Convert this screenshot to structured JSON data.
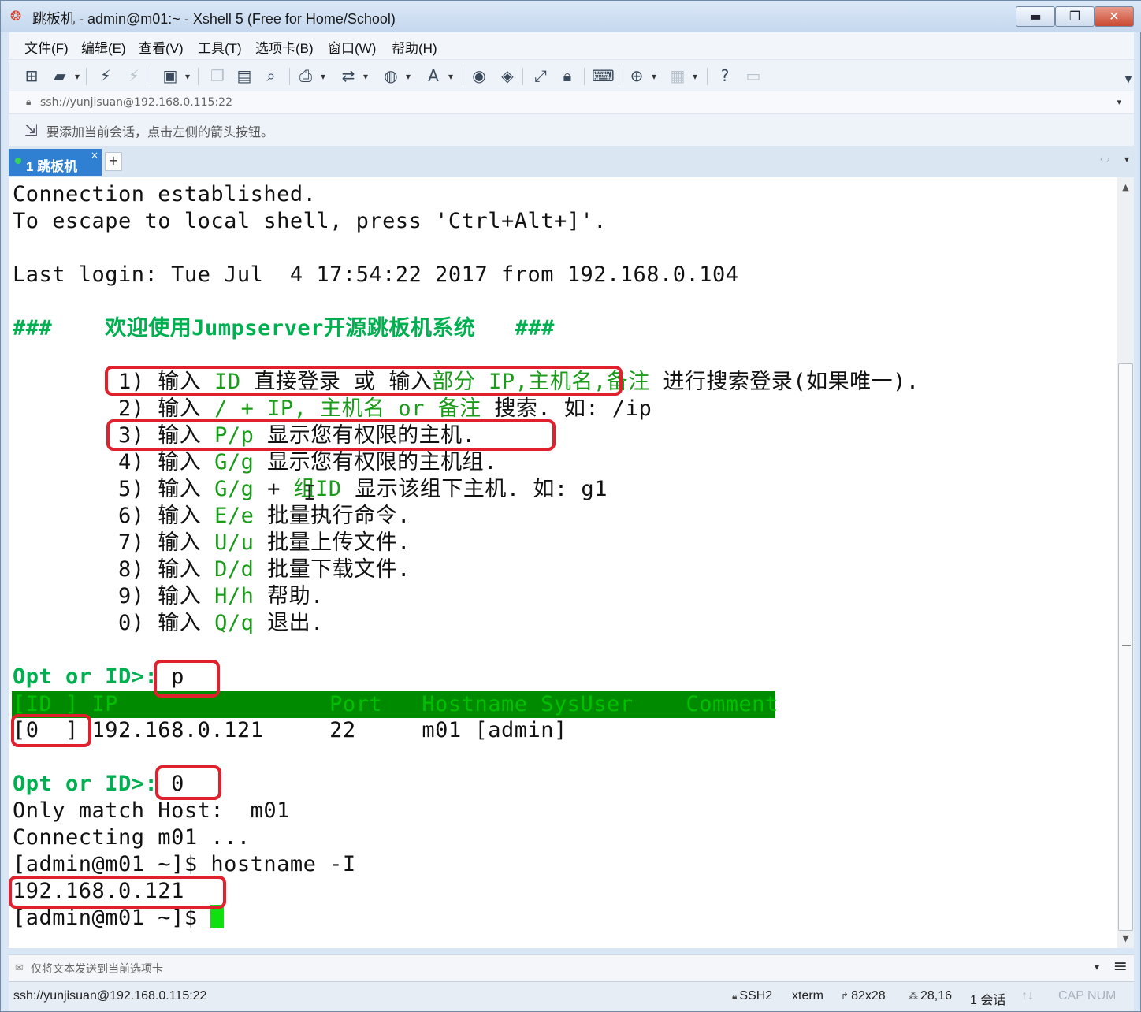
{
  "window": {
    "title": "跳板机 - admin@m01:~ - Xshell 5 (Free for Home/School)",
    "controls": {
      "minimize": "▬",
      "maximize": "❐",
      "close": "✕"
    }
  },
  "menu": [
    "文件(F)",
    "编辑(E)",
    "查看(V)",
    "工具(T)",
    "选项卡(B)",
    "窗口(W)",
    "帮助(H)"
  ],
  "toolbar": {
    "icons": [
      "new-session-icon",
      "open-folder-icon",
      "connect-icon",
      "disconnect-icon",
      "properties-icon",
      "copy-icon",
      "paste-icon",
      "find-icon",
      "print-icon",
      "transfer-icon",
      "globe-icon",
      "font-icon",
      "script-icon",
      "xftp-icon",
      "fullscreen-icon",
      "lock-icon",
      "keyboard-icon",
      "add-tab-icon",
      "layout-icon",
      "help-icon",
      "chat-icon"
    ]
  },
  "address": {
    "text": "ssh://yunjisuan@192.168.0.115:22"
  },
  "hint": {
    "text": "要添加当前会话，点击左侧的箭头按钮。"
  },
  "tabs": [
    {
      "label": "1 跳板机",
      "active": true
    }
  ],
  "terminal": {
    "l1": "Connection established.",
    "l2": "To escape to local shell, press 'Ctrl+Alt+]'.",
    "l3": "Last login: Tue Jul  4 17:54:22 2017 from 192.168.0.104",
    "welcome": "###    欢迎使用Jumpserver开源跳板机系统   ###",
    "m1a": "        1) 输入 ",
    "m1b": "ID",
    "m1c": " 直接登录 或 输入",
    "m1d": "部分 IP,主机名,备注",
    "m1e": " 进行搜索登录(如果唯一).",
    "m2a": "        2) 输入 ",
    "m2b": "/ + IP, 主机名 or 备注",
    "m2c": " 搜索. 如: /ip",
    "m3a": "        3) 输入 ",
    "m3b": "P/p",
    "m3c": " 显示您有权限的主机.",
    "m4a": "        4) 输入 ",
    "m4b": "G/g",
    "m4c": " 显示您有权限的主机组.",
    "m5a": "        5) 输入 ",
    "m5b": "G/g",
    "m5c": " + ",
    "m5d": "组ID",
    "m5e": " 显示该组下主机. 如: g1",
    "m6a": "        6) 输入 ",
    "m6b": "E/e",
    "m6c": " 批量执行命令.",
    "m7a": "        7) 输入 ",
    "m7b": "U/u",
    "m7c": " 批量上传文件.",
    "m8a": "        8) 输入 ",
    "m8b": "D/d",
    "m8c": " 批量下载文件.",
    "m9a": "        9) 输入 ",
    "m9b": "H/h",
    "m9c": " 帮助.",
    "m0a": "        0) 输入 ",
    "m0b": "Q/q",
    "m0c": " 退出.",
    "prompt1": "Opt or ID>:",
    "input1": " p",
    "table_header": "[ID ] IP                Port   Hostname SysUser    Comment",
    "table_row": "[0  ] 192.168.0.121     22     m01 [admin]",
    "prompt2": "Opt or ID>:",
    "input2": " 0",
    "l_only": "Only match Host:  m01",
    "l_conn": "Connecting m01 ...",
    "l_cmd": "[admin@m01 ~]$ hostname -I",
    "l_ip": "192.168.0.121",
    "l_prompt": "[admin@m01 ~]$ "
  },
  "sendbar": {
    "text": "仅将文本发送到当前选项卡"
  },
  "status": {
    "address": "ssh://yunjisuan@192.168.0.115:22",
    "protocol": "SSH2",
    "term": "xterm",
    "size": "82x28",
    "cursor": "28,16",
    "sessions": "1 会话",
    "capnum": "CAP NUM"
  },
  "colors": {
    "highlight_box": "#e0202c",
    "menu_green": "#00b050",
    "header_bg": "#008a00",
    "cursor": "#10e010",
    "tab_active": "#2f7fd3"
  }
}
